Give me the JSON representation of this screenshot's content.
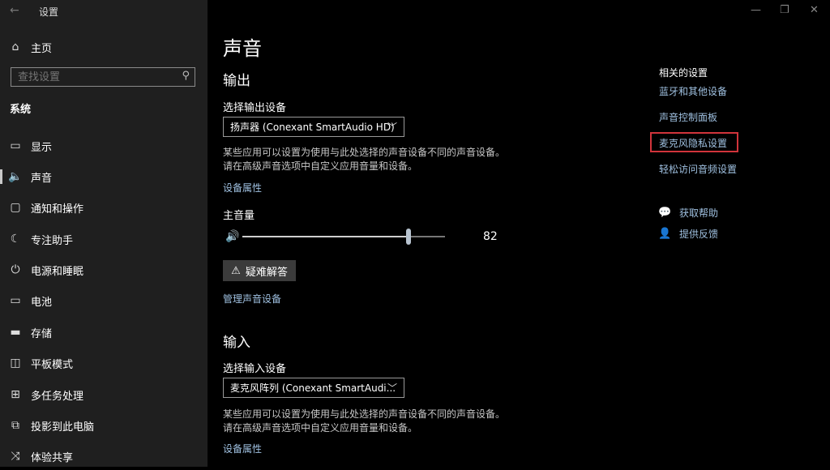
{
  "window": {
    "app_title": "设置",
    "back_glyph": "←",
    "minimize": "—",
    "restore": "❐",
    "close": "✕"
  },
  "sidebar": {
    "home": {
      "label": "主页",
      "icon": "home-icon"
    },
    "search": {
      "placeholder": "查找设置",
      "icon": "search-icon"
    },
    "section": "系统",
    "items": [
      {
        "label": "显示",
        "icon": "display-icon"
      },
      {
        "label": "声音",
        "icon": "speaker-icon",
        "active": true
      },
      {
        "label": "通知和操作",
        "icon": "notification-icon"
      },
      {
        "label": "专注助手",
        "icon": "moon-icon"
      },
      {
        "label": "电源和睡眠",
        "icon": "power-icon"
      },
      {
        "label": "电池",
        "icon": "battery-icon"
      },
      {
        "label": "存储",
        "icon": "storage-icon"
      },
      {
        "label": "平板模式",
        "icon": "tablet-icon"
      },
      {
        "label": "多任务处理",
        "icon": "multitask-icon"
      },
      {
        "label": "投影到此电脑",
        "icon": "project-icon"
      },
      {
        "label": "体验共享",
        "icon": "share-icon"
      }
    ]
  },
  "main": {
    "title": "声音",
    "output": {
      "heading": "输出",
      "select_label": "选择输出设备",
      "device": "扬声器 (Conexant SmartAudio HD)",
      "desc1": "某些应用可以设置为使用与此处选择的声音设备不同的声音设备。",
      "desc2": "请在高级声音选项中自定义应用音量和设备。",
      "properties_link": "设备属性",
      "master_volume_label": "主音量",
      "volume": 82,
      "volume_text": "82",
      "troubleshoot": "疑难解答",
      "manage_link": "管理声音设备"
    },
    "input": {
      "heading": "输入",
      "select_label": "选择输入设备",
      "device": "麦克风阵列 (Conexant SmartAudi...",
      "desc1": "某些应用可以设置为使用与此处选择的声音设备不同的声音设备。",
      "desc2": "请在高级声音选项中自定义应用音量和设备。",
      "properties_link": "设备属性"
    }
  },
  "related": {
    "title": "相关的设置",
    "links": [
      "蓝牙和其他设备",
      "声音控制面板",
      "麦克风隐私设置",
      "轻松访问音频设置"
    ],
    "help": "获取帮助",
    "feedback": "提供反馈",
    "highlight_color": "#d1343b"
  }
}
